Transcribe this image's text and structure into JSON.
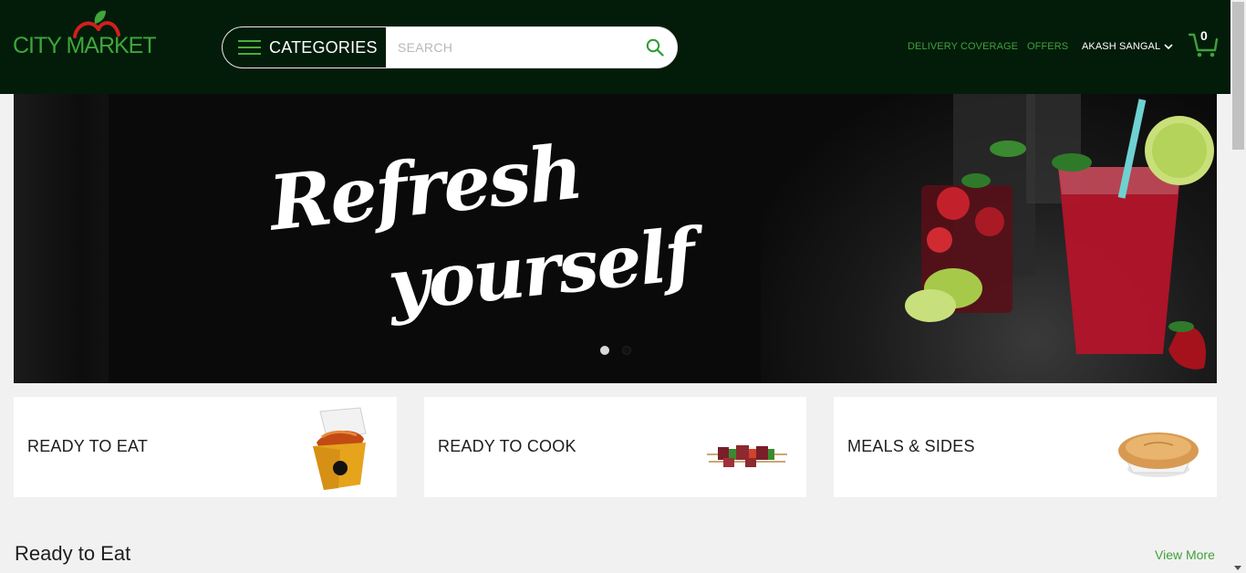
{
  "header": {
    "logo_text": "CITY MARKET",
    "categories_label": "CATEGORIES",
    "search_placeholder": "SEARCH",
    "nav": {
      "delivery": "DELIVERY COVERAGE",
      "offers": "OFFERS",
      "user": "AKASH SANGAL"
    },
    "cart_count": "0"
  },
  "banner": {
    "headline_line1": "Refresh",
    "headline_line2": "yourself",
    "slides_total": 2,
    "active_slide": 1
  },
  "categories": [
    {
      "label": "READY TO EAT",
      "icon": "noodle-box-icon"
    },
    {
      "label": "READY TO COOK",
      "icon": "skewers-icon"
    },
    {
      "label": "MEALS & SIDES",
      "icon": "pie-icon"
    }
  ],
  "section": {
    "title": "Ready to Eat",
    "view_more": "View More"
  },
  "colors": {
    "header_bg": "#031c0a",
    "accent_green": "#3fa13a",
    "page_bg": "#f1f1f1"
  }
}
